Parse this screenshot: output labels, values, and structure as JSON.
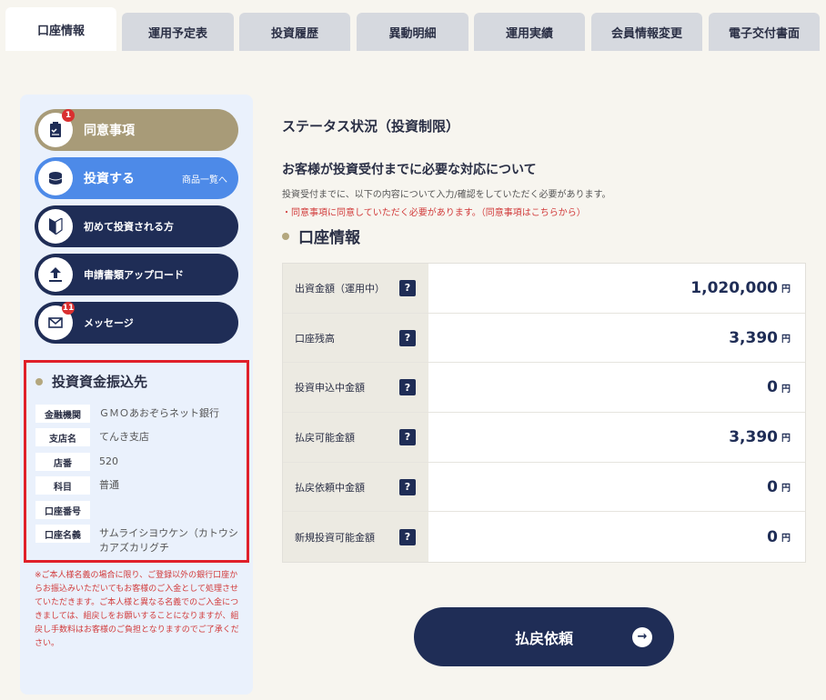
{
  "tabs": [
    {
      "label": "口座情報"
    },
    {
      "label": "運用予定表"
    },
    {
      "label": "投資履歴"
    },
    {
      "label": "異動明細"
    },
    {
      "label": "運用実績"
    },
    {
      "label": "会員情報変更"
    },
    {
      "label": "電子交付書面"
    }
  ],
  "sidebar": {
    "consent": {
      "label": "同意事項",
      "badge": "1",
      "icon": "clipboard-icon"
    },
    "invest": {
      "label": "投資する",
      "sub": "商品一覧へ",
      "icon": "coins-icon"
    },
    "first_time": {
      "label": "初めて投資される方",
      "icon": "beginner-mark-icon"
    },
    "upload": {
      "label": "申請書類アップロード",
      "icon": "upload-icon"
    },
    "message": {
      "label": "メッセージ",
      "badge": "11",
      "icon": "mail-icon"
    },
    "transfer": {
      "title": "投資資金振込先",
      "rows": [
        {
          "key": "金融機関",
          "value": "ＧＭＯあおぞらネット銀行"
        },
        {
          "key": "支店名",
          "value": "てんき支店"
        },
        {
          "key": "店番",
          "value": "520"
        },
        {
          "key": "科目",
          "value": "普通"
        },
        {
          "key": "口座番号",
          "value": ""
        },
        {
          "key": "口座名義",
          "value": "サムライシヨウケン（カトウシカアズカリグチ"
        }
      ]
    },
    "note": "※ご本人様名義の場合に限り、ご登録以外の銀行口座からお振込みいただいてもお客様のご入金として処理させていただきます。ご本人様と異なる名義でのご入金につきましては、組戻しをお願いすることになりますが、組戻し手数料はお客様のご負担となりますのでご了承ください。"
  },
  "main": {
    "status_title": "ステータス状況（投資制限）",
    "requirement_title": "お客様が投資受付までに必要な対応について",
    "requirement_desc": "投資受付までに、以下の内容について入力/確認をしていただく必要があります。",
    "requirement_link": "・同意事項に同意していただく必要があります。（同意事項はこちらから）",
    "account_title": "口座情報",
    "help_label": "?",
    "currency": "円",
    "rows": [
      {
        "label": "出資金額（運用中）",
        "amount": "1,020,000"
      },
      {
        "label": "口座残高",
        "amount": "3,390"
      },
      {
        "label": "投資申込中金額",
        "amount": "0"
      },
      {
        "label": "払戻可能金額",
        "amount": "3,390"
      },
      {
        "label": "払戻依頼中金額",
        "amount": "0"
      },
      {
        "label": "新規投資可能金額",
        "amount": "0"
      }
    ],
    "refund_button": "払戻依頼"
  }
}
